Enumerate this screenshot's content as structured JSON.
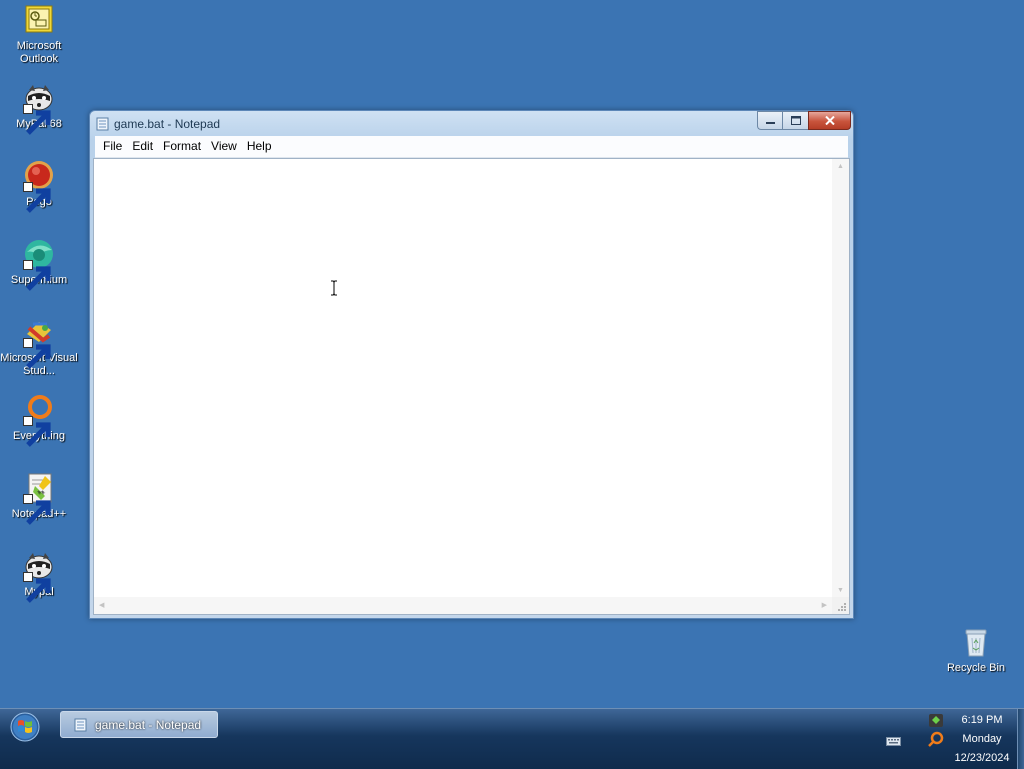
{
  "desktop": {
    "icons": [
      {
        "label": "Microsoft Outlook",
        "icon": "outlook-icon"
      },
      {
        "label": "MyPal 68",
        "icon": "mypal-icon"
      },
      {
        "label": "Pego",
        "icon": "pego-icon"
      },
      {
        "label": "Supermium",
        "icon": "supermium-icon"
      },
      {
        "label": "Microsoft Visual Stud...",
        "icon": "visual-studio-icon"
      },
      {
        "label": "Everything",
        "icon": "everything-icon"
      },
      {
        "label": "Notepad++",
        "icon": "notepadplusplus-icon"
      },
      {
        "label": "Mypal",
        "icon": "mypal-icon"
      }
    ],
    "recycle_bin": {
      "label": "Recycle Bin",
      "icon": "recycle-bin-icon"
    }
  },
  "window": {
    "title": "game.bat - Notepad",
    "menu": [
      "File",
      "Edit",
      "Format",
      "View",
      "Help"
    ],
    "content": ""
  },
  "taskbar": {
    "task_button_label": "game.bat - Notepad",
    "clock": {
      "time": "6:19 PM",
      "day": "Monday",
      "date": "12/23/2024"
    }
  },
  "colors": {
    "desktop": "#3b74b3",
    "close_button": "#c8543c",
    "taskbar": "#16365d"
  }
}
